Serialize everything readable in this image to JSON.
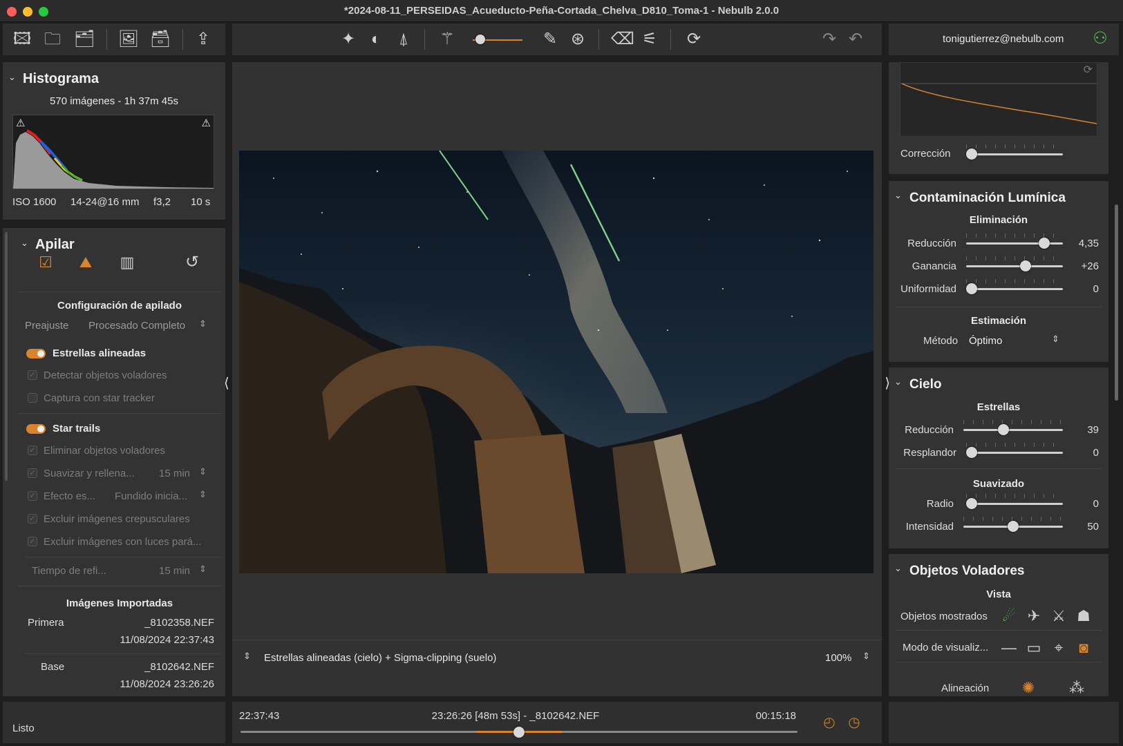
{
  "window": {
    "title": "*2024-08-11_PERSEIDAS_Acueducto-Peña-Cortada_Chelva_D810_Toma-1 - Nebulb 2.0.0"
  },
  "account": {
    "email": "tonigutierrez@nebulb.com"
  },
  "histogram": {
    "title": "Histograma",
    "summary": "570 imágenes - 1h 37m 45s",
    "iso": "ISO 1600",
    "lens": "14-24@16 mm",
    "aperture": "f3,2",
    "exposure": "10 s"
  },
  "stack": {
    "title": "Apilar",
    "config_title": "Configuración de apilado",
    "preset_label": "Preajuste",
    "preset_value": "Procesado Completo",
    "aligned_label": "Estrellas alineadas",
    "aligned_opts": [
      "Detectar objetos voladores",
      "Captura con star tracker"
    ],
    "trails_label": "Star trails",
    "remove_flying": "Eliminar objetos voladores",
    "smooth_label": "Suavizar y rellena...",
    "smooth_value": "15 min",
    "effect_label": "Efecto es...",
    "effect_value": "Fundido inicia...",
    "exclude_twilight": "Excluir imágenes crepusculares",
    "exclude_lights": "Excluir imágenes con luces pará...",
    "refresh_label": "Tiempo de refi...",
    "refresh_value": "15 min",
    "imported_title": "Imágenes Importadas",
    "first_label": "Primera",
    "first_file": "_8102358.NEF",
    "first_date": "11/08/2024 22:37:43",
    "base_label": "Base",
    "base_file": "_8102642.NEF",
    "base_date": "11/08/2024 23:26:26"
  },
  "status": {
    "text": "Listo"
  },
  "viewer": {
    "mode": "Estrellas alineadas (cielo) + Sigma-clipping (suelo)",
    "zoom": "100%"
  },
  "timeline": {
    "start": "22:37:43",
    "current": "23:26:26 [48m 53s] - _8102642.NEF",
    "end": "00:15:18",
    "position": 0.5
  },
  "correction": {
    "label": "Corrección",
    "value_fraction": 0.0
  },
  "light_pollution": {
    "title": "Contaminación Lumínica",
    "removal_title": "Eliminación",
    "reduction_label": "Reducción",
    "reduction_value": "4,35",
    "reduction_fraction": 0.85,
    "gain_label": "Ganancia",
    "gain_value": "+26",
    "gain_fraction": 0.63,
    "uniformity_label": "Uniformidad",
    "uniformity_value": "0",
    "uniformity_fraction": 0.0,
    "estimation_title": "Estimación",
    "method_label": "Método",
    "method_value": "Óptimo"
  },
  "sky": {
    "title": "Cielo",
    "stars_title": "Estrellas",
    "reduction_label": "Reducción",
    "reduction_value": "39",
    "reduction_fraction": 0.39,
    "glow_label": "Resplandor",
    "glow_value": "0",
    "glow_fraction": 0.0,
    "smoothing_title": "Suavizado",
    "radius_label": "Radio",
    "radius_value": "0",
    "radius_fraction": 0.0,
    "intensity_label": "Intensidad",
    "intensity_value": "50",
    "intensity_fraction": 0.5
  },
  "flying": {
    "title": "Objetos Voladores",
    "view_title": "Vista",
    "shown_label": "Objetos mostrados",
    "mode_label": "Modo de visualiz...",
    "align_label": "Alineación"
  },
  "colors": {
    "accent": "#d9842c",
    "green": "#4cc14c"
  }
}
